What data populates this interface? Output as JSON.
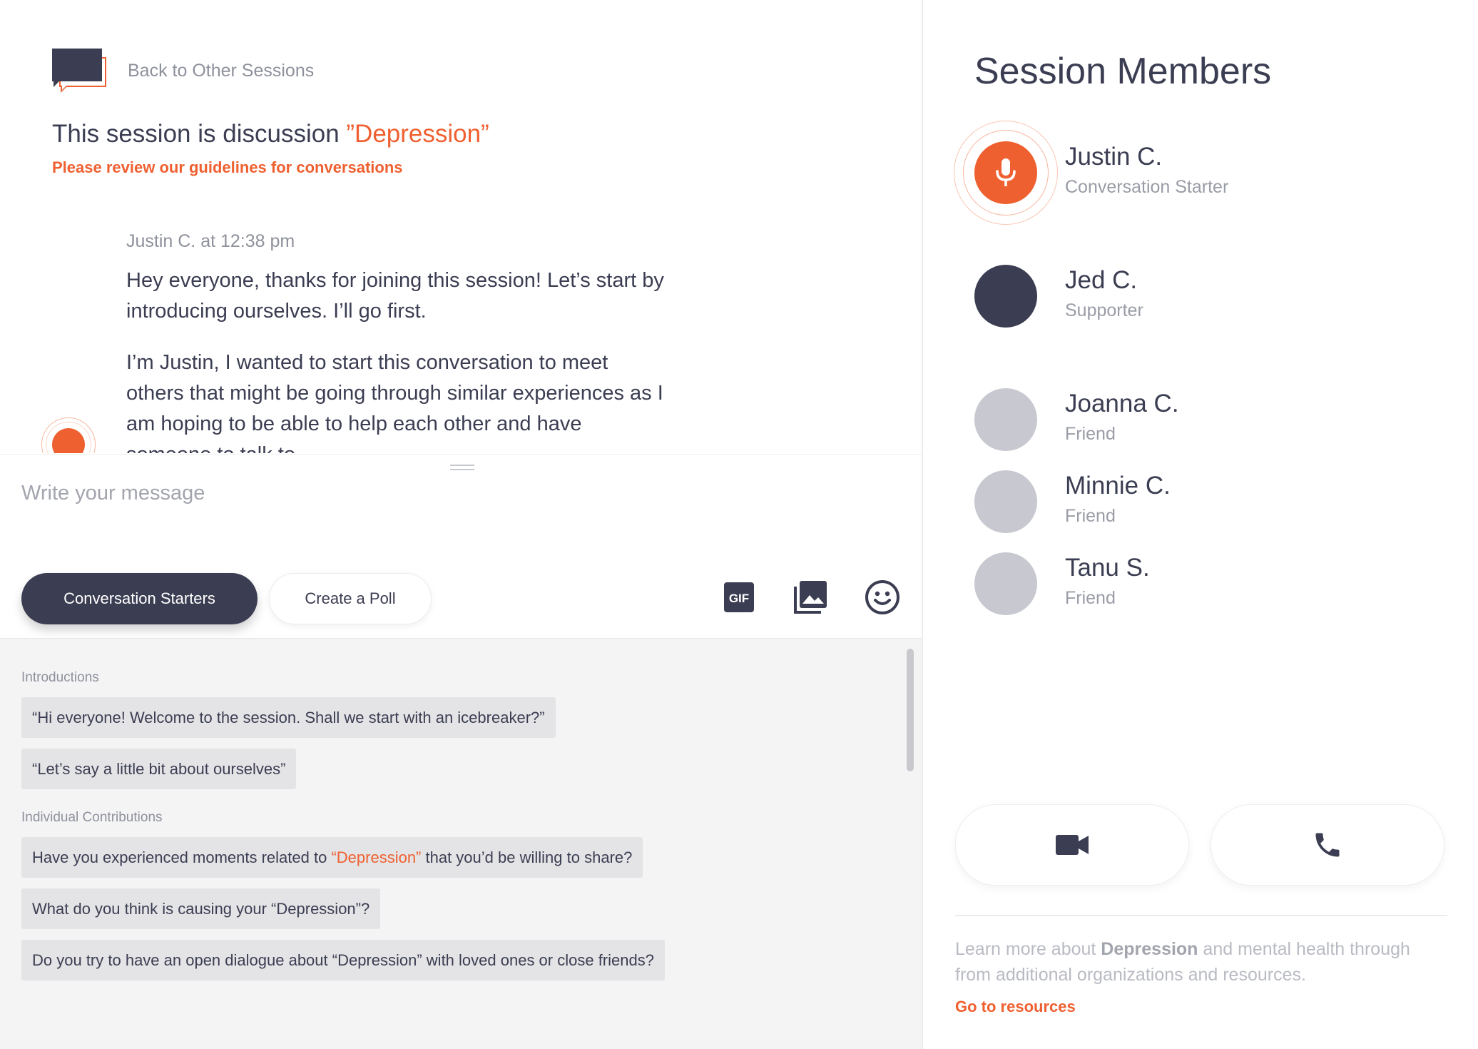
{
  "header": {
    "back_label": "Back to Other Sessions",
    "topic_prefix": "This session is discussion ",
    "topic_name": "”Depression”",
    "guidelines_link": "Please review our guidelines for conversations"
  },
  "chat": {
    "messages": [
      {
        "meta": "Justin C. at 12:38 pm",
        "paragraphs": [
          "Hey everyone, thanks for joining this session! Let’s start by introducing ourselves. I’ll go first.",
          "I’m Justin, I wanted to start this conversation to meet others that might be going through similar experiences as I am hoping to be able to help each other and have someone to talk to."
        ]
      }
    ]
  },
  "composer": {
    "placeholder": "Write your message",
    "conversation_starters_label": "Conversation Starters",
    "create_poll_label": "Create a Poll",
    "gif_label": "GIF"
  },
  "starters": {
    "introductions_label": "Introductions",
    "introductions": [
      "“Hi everyone! Welcome to the session. Shall we start with an icebreaker?”",
      "“Let’s say a little bit about ourselves”"
    ],
    "individual_label": "Individual Contributions",
    "individual": {
      "first_before": "Have you experienced moments related to ",
      "first_topic": "“Depression”",
      "first_after": " that you’d be willing to share?",
      "second": "What do you think is causing your “Depression”?",
      "third": "Do you try to have an open dialogue about “Depression” with loved ones or close friends?"
    }
  },
  "members": {
    "title": "Session Members",
    "list": [
      {
        "name": "Justin C.",
        "role": "Conversation Starter",
        "status": "speaking",
        "color": "#ef6030"
      },
      {
        "name": "Jed C.",
        "role": "Supporter",
        "status": "online",
        "color": "#3b3d52"
      },
      {
        "name": "Joanna C.",
        "role": "Friend",
        "status": "offline",
        "color": "#c7c8d0"
      },
      {
        "name": "Minnie C.",
        "role": "Friend",
        "status": "offline",
        "color": "#c7c8d0"
      },
      {
        "name": "Tanu S.",
        "role": "Friend",
        "status": "offline",
        "color": "#c7c8d0"
      }
    ]
  },
  "footer": {
    "learn_before": "Learn more about ",
    "learn_topic": "Depression",
    "learn_after": " and mental health through from additional organizations and resources.",
    "resources_link": "Go to resources"
  },
  "colors": {
    "accent": "#ef6030",
    "dark": "#3b3d52",
    "muted": "#8e919c",
    "panel": "#f4f4f5",
    "chip": "#e4e4e6"
  }
}
